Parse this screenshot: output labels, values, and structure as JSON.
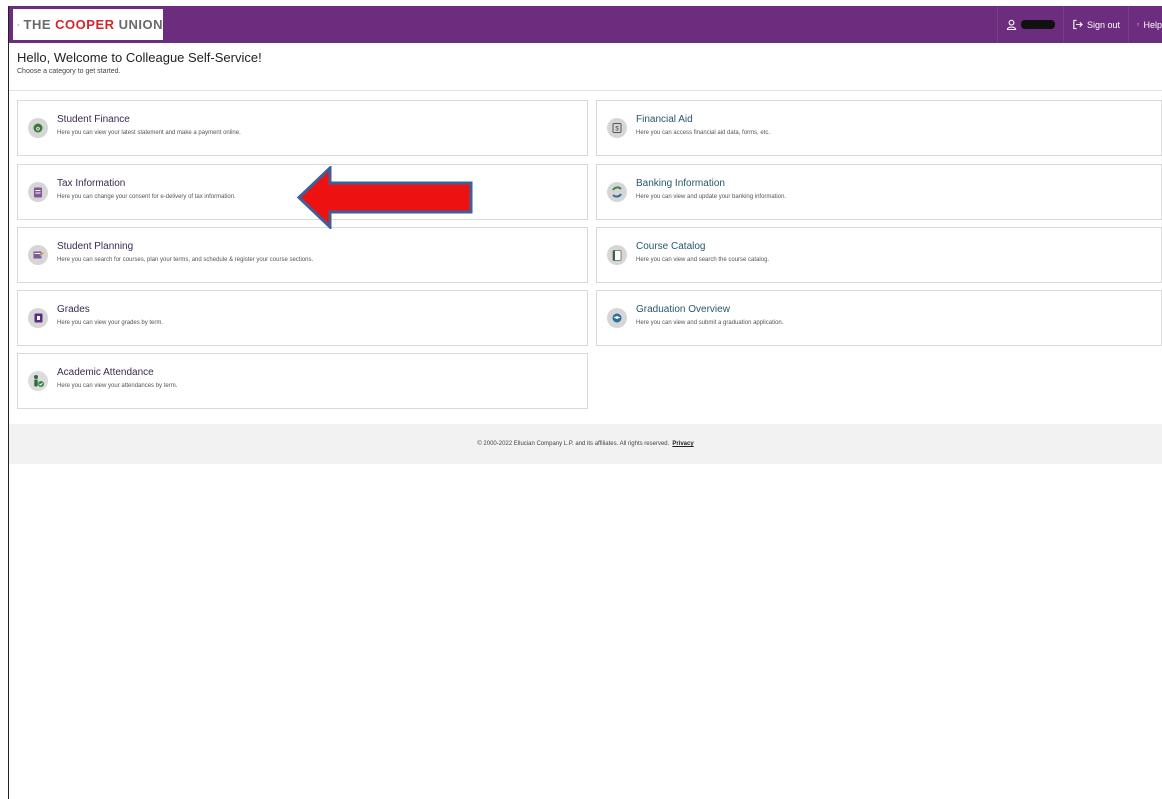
{
  "header": {
    "logo_text_prefix": "THE ",
    "logo_text_red": "COOPER",
    "logo_text_suffix": " UNION",
    "sign_out_label": "Sign out",
    "help_label": "Help"
  },
  "greeting": {
    "title": "Hello, Welcome to Colleague Self-Service!",
    "subtitle": "Choose a category to get started."
  },
  "tiles": {
    "student_finance": {
      "title": "Student Finance",
      "desc": "Here you can view your latest statement and make a payment online.",
      "icon": "dollar-icon"
    },
    "financial_aid": {
      "title": "Financial Aid",
      "desc": "Here you can access financial aid data, forms, etc.",
      "icon": "financial-aid-icon"
    },
    "tax_information": {
      "title": "Tax Information",
      "desc": "Here you can change your consent for e-delivery of tax information.",
      "icon": "tax-document-icon"
    },
    "banking_information": {
      "title": "Banking Information",
      "desc": "Here you can view and update your banking information.",
      "icon": "banking-icon"
    },
    "student_planning": {
      "title": "Student Planning",
      "desc": "Here you can search for courses, plan your terms, and schedule & register your course sections.",
      "icon": "planning-icon"
    },
    "course_catalog": {
      "title": "Course Catalog",
      "desc": "Here you can view and search the course catalog.",
      "icon": "catalog-icon"
    },
    "grades": {
      "title": "Grades",
      "desc": "Here you can view your grades by term.",
      "icon": "grades-icon"
    },
    "graduation_overview": {
      "title": "Graduation Overview",
      "desc": "Here you can view and submit a graduation application.",
      "icon": "graduation-cap-icon"
    },
    "academic_attendance": {
      "title": "Academic Attendance",
      "desc": "Here you can view your attendances by term.",
      "icon": "attendance-icon"
    }
  },
  "footer": {
    "copyright": "© 2000-2022 Ellucian Company L.P. and its affiliates. All rights reserved.",
    "privacy_label": "Privacy"
  },
  "colors": {
    "header_bg": "#6c2d7e",
    "annotation_arrow_fill": "#ee1111",
    "annotation_arrow_outline": "#3f5f9a"
  }
}
